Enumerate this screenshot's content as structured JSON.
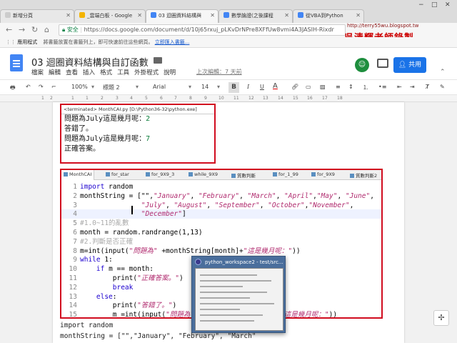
{
  "browser": {
    "tabs": [
      {
        "label": "新增分頁",
        "color": "#cccccc"
      },
      {
        "label": "_雲端白板 - Google",
        "color": "#f4b400"
      },
      {
        "label": "03 迴圈資料結構與",
        "color": "#4285f4"
      },
      {
        "label": "數學論證(之後課程",
        "color": "#4285f4"
      },
      {
        "label": "從VBA到Python",
        "color": "#4285f4"
      }
    ],
    "window_controls": [
      "−",
      "□",
      "✕"
    ],
    "secure_label": "安全",
    "url": "https://docs.google.com/document/d/10j65rxuj_pLKvDrNPre8XFfUw8vmi4A3JASIH-Rixdr"
  },
  "watermark": {
    "url": "http://terry55wu.blogspot.tw",
    "name": "吳清輝老師錄製"
  },
  "bookmarks": {
    "apps_label": "應用程式",
    "hint_text": "將書籤放置在書籤列上，即可快速前往這些網頁。",
    "import_link": "立即匯入書籤..."
  },
  "doc": {
    "title": "03 迴圈資料結構與自訂函數",
    "menu": [
      "檔案",
      "編輯",
      "查看",
      "插入",
      "格式",
      "工具",
      "外掛程式",
      "說明"
    ],
    "last_edit": "上次編輯：7 天前",
    "share_label": "共用",
    "avatar_letter": "☺"
  },
  "toolbar": {
    "zoom": "100%",
    "style": "標題 2",
    "font": "Arial",
    "size": "14",
    "bold": "B",
    "italic": "I",
    "underline": "U",
    "color": "A"
  },
  "ruler": [
    "1",
    "2",
    "1",
    "1",
    "2",
    "3",
    "4",
    "5",
    "6",
    "7",
    "8",
    "9",
    "10",
    "11",
    "12",
    "13",
    "14",
    "15",
    "16",
    "17",
    "18"
  ],
  "console": {
    "header": "<terminated> MonthCAI.py [D:\\Python36-32\\python.exe]",
    "lines": [
      {
        "text": "問題為July這是幾月呢：",
        "value": "2"
      },
      {
        "text": "答錯了。",
        "value": ""
      },
      {
        "text": "問題為July這是幾月呢：",
        "value": "7"
      },
      {
        "text": "正確答案。",
        "value": ""
      }
    ]
  },
  "editor": {
    "tabs": [
      "MonthCAI",
      "for_star",
      "for_9X9_3",
      "while_9X9",
      "質數判斷",
      "for_1_99",
      "for_9X9",
      "質數判斷2"
    ],
    "lines": [
      {
        "n": "1",
        "parts": [
          {
            "t": "kw",
            "v": "import"
          },
          {
            "t": "",
            "v": " random"
          }
        ]
      },
      {
        "n": "2",
        "parts": [
          {
            "t": "",
            "v": "monthString = [\"\","
          },
          {
            "t": "str",
            "v": "\"January\""
          },
          {
            "t": "",
            "v": ", "
          },
          {
            "t": "str",
            "v": "\"February\""
          },
          {
            "t": "",
            "v": ", "
          },
          {
            "t": "str",
            "v": "\"March\""
          },
          {
            "t": "",
            "v": ", "
          },
          {
            "t": "str",
            "v": "\"April\""
          },
          {
            "t": "",
            "v": ","
          },
          {
            "t": "str",
            "v": "\"May\""
          },
          {
            "t": "",
            "v": ", "
          },
          {
            "t": "str",
            "v": "\"June\""
          },
          {
            "t": "",
            "v": ","
          }
        ]
      },
      {
        "n": "3",
        "parts": [
          {
            "t": "",
            "v": "               "
          },
          {
            "t": "str",
            "v": "\"July\""
          },
          {
            "t": "",
            "v": ", "
          },
          {
            "t": "str",
            "v": "\"August\""
          },
          {
            "t": "",
            "v": ", "
          },
          {
            "t": "str",
            "v": "\"September\""
          },
          {
            "t": "",
            "v": ", "
          },
          {
            "t": "str",
            "v": "\"October\""
          },
          {
            "t": "",
            "v": ","
          },
          {
            "t": "str",
            "v": "\"November\""
          },
          {
            "t": "",
            "v": ","
          }
        ]
      },
      {
        "n": "4",
        "parts": [
          {
            "t": "",
            "v": "               "
          },
          {
            "t": "str",
            "v": "\"December\""
          },
          {
            "t": "",
            "v": "]"
          }
        ]
      },
      {
        "n": "5",
        "parts": [
          {
            "t": "cm",
            "v": "#1.0~11的亂數"
          }
        ]
      },
      {
        "n": "6",
        "parts": [
          {
            "t": "",
            "v": "month = random.randrange(1,13)"
          }
        ]
      },
      {
        "n": "7",
        "parts": [
          {
            "t": "cm",
            "v": "#2.判斷是否正確"
          }
        ]
      },
      {
        "n": "8",
        "parts": [
          {
            "t": "",
            "v": "m=int(input("
          },
          {
            "t": "str",
            "v": "\"問題為\""
          },
          {
            "t": "",
            "v": " +monthString[month]+"
          },
          {
            "t": "str",
            "v": "\"這是幾月呢：\""
          },
          {
            "t": "",
            "v": "))"
          }
        ]
      },
      {
        "n": "9",
        "parts": [
          {
            "t": "kw",
            "v": "while"
          },
          {
            "t": "",
            "v": " 1:"
          }
        ]
      },
      {
        "n": "10",
        "parts": [
          {
            "t": "",
            "v": "    "
          },
          {
            "t": "kw",
            "v": "if"
          },
          {
            "t": "",
            "v": " m == month:"
          }
        ]
      },
      {
        "n": "11",
        "parts": [
          {
            "t": "",
            "v": "        print("
          },
          {
            "t": "str",
            "v": "\"正確答案。\""
          },
          {
            "t": "",
            "v": ")"
          }
        ]
      },
      {
        "n": "12",
        "parts": [
          {
            "t": "",
            "v": "        "
          },
          {
            "t": "kw",
            "v": "break"
          }
        ]
      },
      {
        "n": "13",
        "parts": [
          {
            "t": "",
            "v": "    "
          },
          {
            "t": "kw",
            "v": "else"
          },
          {
            "t": "",
            "v": ":"
          }
        ]
      },
      {
        "n": "14",
        "parts": [
          {
            "t": "",
            "v": "        print("
          },
          {
            "t": "str",
            "v": "\"答錯了。\""
          },
          {
            "t": "",
            "v": ")"
          }
        ]
      },
      {
        "n": "15",
        "parts": [
          {
            "t": "",
            "v": "        m =int(input("
          },
          {
            "t": "str",
            "v": "\"問題為\""
          },
          {
            "t": "",
            "v": " +monthString[month]+"
          },
          {
            "t": "str",
            "v": "\"這是幾月呢：\""
          },
          {
            "t": "",
            "v": "))"
          }
        ]
      }
    ]
  },
  "popup": {
    "title": "python_workspace2 - test/src..."
  },
  "below_code": [
    "import random",
    "monthString = [\"\",\"January\", \"February\", \"March\""
  ],
  "help_label": "✢",
  "colors": {
    "highlight_border": "#d10c1f",
    "keyword": "#1c00cf",
    "string": "#b02a6e",
    "share_button": "#1a73e8"
  }
}
